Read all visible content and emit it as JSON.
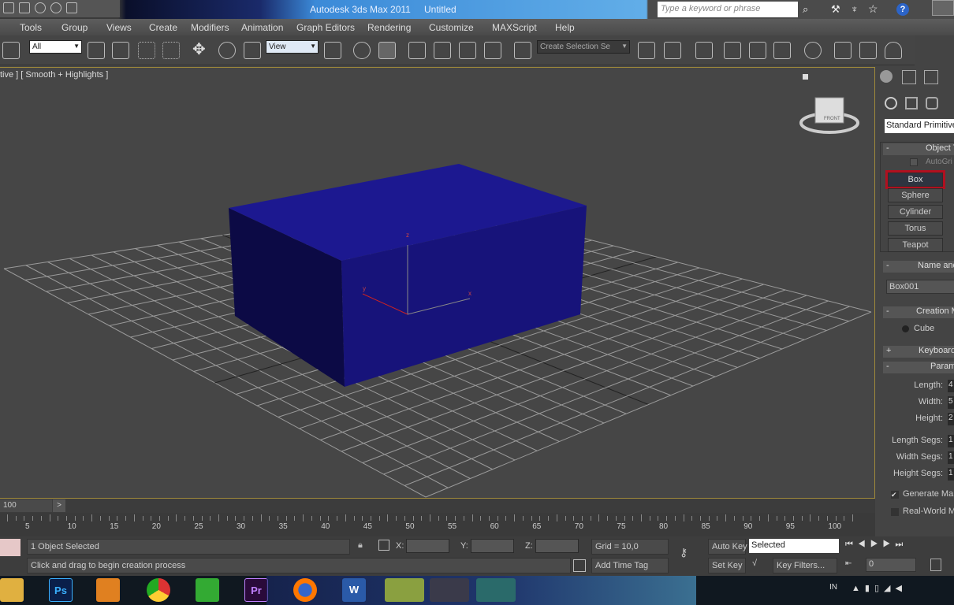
{
  "titlebar": {
    "app": "Autodesk 3ds Max 2011",
    "document": "Untitled",
    "search_placeholder": "Type a keyword or phrase"
  },
  "menu": [
    "Tools",
    "Group",
    "Views",
    "Create",
    "Modifiers",
    "Animation",
    "Graph Editors",
    "Rendering",
    "Customize",
    "MAXScript",
    "Help"
  ],
  "toolbar": {
    "selection_filter": "All",
    "reference_coord": "View",
    "named_selection": "Create Selection Se"
  },
  "viewport": {
    "label": "tive ] [ Smooth + Highlights ]",
    "object_color": "#17137a",
    "viewcube_label": "FRONT",
    "axis_labels": {
      "x": "x",
      "y": "y",
      "z": "z"
    }
  },
  "command_panel": {
    "category": "Standard Primitive",
    "object_type": {
      "title": "Object T",
      "autogrid": "AutoGri",
      "buttons": [
        "Box",
        "Sphere",
        "Cylinder",
        "Torus",
        "Teapot"
      ],
      "active": "Box",
      "active_color": "#b01020"
    },
    "name_color": {
      "title": "Name and",
      "name": "Box001"
    },
    "creation_method": {
      "title": "Creation M",
      "option": "Cube"
    },
    "keyboard_entry": {
      "title": "Keyboard"
    },
    "parameters": {
      "title": "Paramet",
      "fields": [
        {
          "label": "Length:",
          "value": "4"
        },
        {
          "label": "Width:",
          "value": "5"
        },
        {
          "label": "Height:",
          "value": "2"
        },
        {
          "label": "Length Segs:",
          "value": "1"
        },
        {
          "label": "Width Segs:",
          "value": "1"
        },
        {
          "label": "Height Segs:",
          "value": "1"
        }
      ],
      "generate_mapping": {
        "label": "Generate Map",
        "checked": true
      },
      "real_world": {
        "label": "Real-World M",
        "checked": false
      }
    }
  },
  "timeline": {
    "frame": "100",
    "next": ">",
    "ticks": [
      "5",
      "10",
      "15",
      "20",
      "25",
      "30",
      "35",
      "40",
      "45",
      "50",
      "55",
      "60",
      "65",
      "70",
      "75",
      "80",
      "85",
      "90",
      "95",
      "100"
    ]
  },
  "status": {
    "selected": "1 Object Selected",
    "prompt": "Click and drag to begin creation process",
    "x_label": "X:",
    "y_label": "Y:",
    "z_label": "Z:",
    "grid": "Grid = 10,0",
    "add_time_tag": "Add Time Tag",
    "auto_key": "Auto Key",
    "set_key": "Set Key",
    "key_mode": "Selected",
    "key_filters": "Key Filters...",
    "current_frame": "0"
  },
  "taskbar": {
    "apps": [
      "Ps",
      "Pr",
      "W"
    ],
    "tray_lang": "IN"
  }
}
